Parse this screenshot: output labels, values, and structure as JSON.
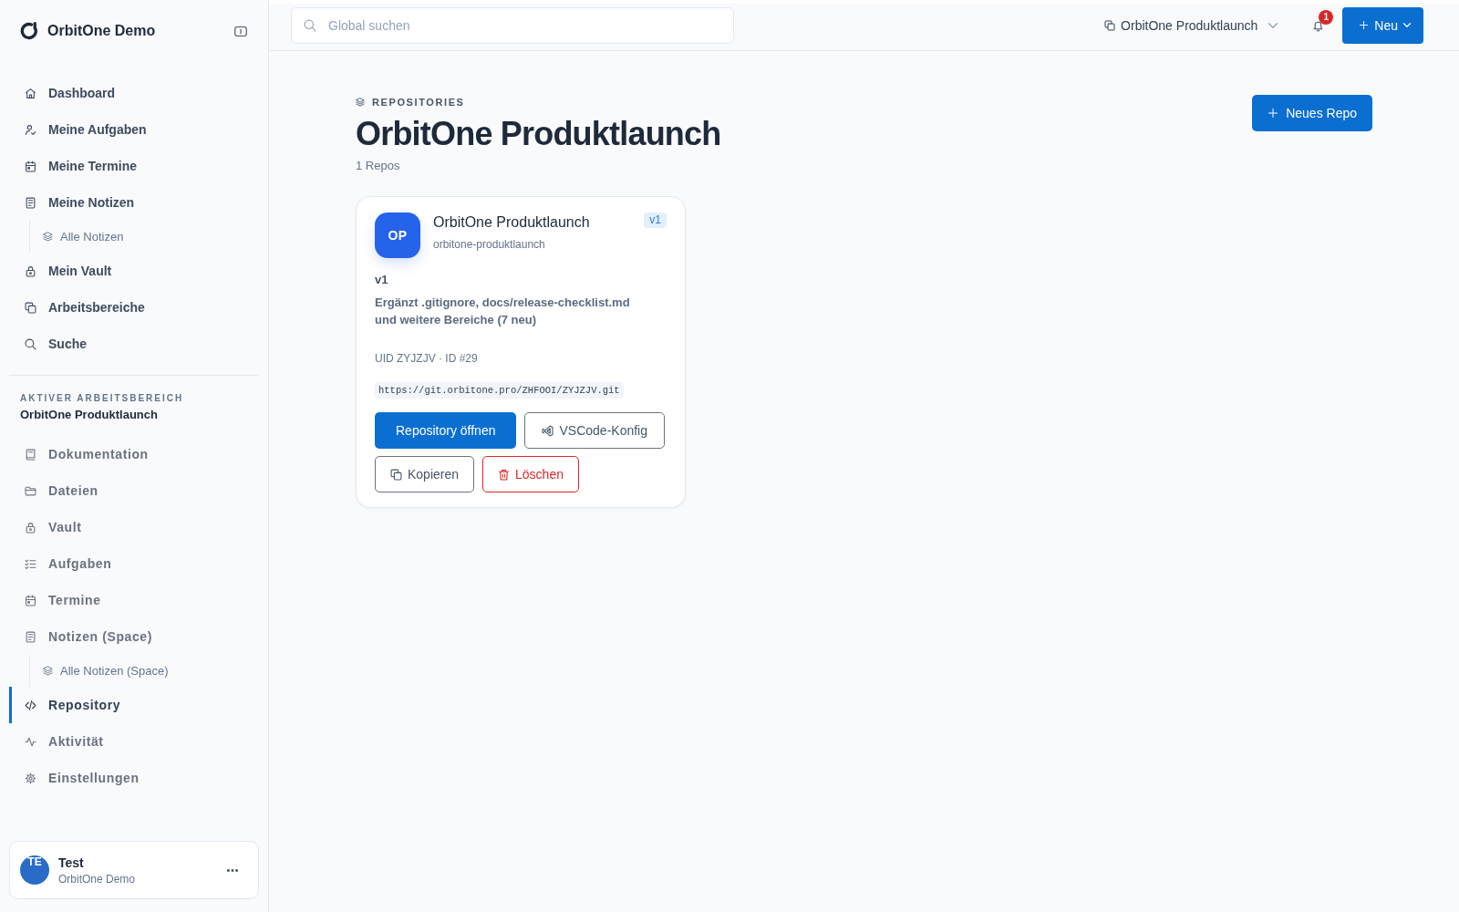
{
  "sidebar": {
    "brand": "OrbitOne Demo",
    "personal_nav": [
      {
        "label": "Dashboard",
        "selected": false
      },
      {
        "label": "Meine Aufgaben",
        "selected": false
      },
      {
        "label": "Meine Termine",
        "selected": false
      },
      {
        "label": "Meine Notizen",
        "selected": false,
        "children": [
          {
            "label": "Alle Notizen",
            "selected": false
          }
        ]
      },
      {
        "label": "Mein Vault",
        "selected": false
      },
      {
        "label": "Arbeitsbereiche",
        "selected": false
      },
      {
        "label": "Suche",
        "selected": false
      }
    ],
    "workspace": {
      "caption": "AKTIVER ARBEITSBEREICH",
      "name": "OrbitOne Produktlaunch"
    },
    "workspace_nav": [
      {
        "label": "Dokumentation",
        "selected": false
      },
      {
        "label": "Dateien",
        "selected": false
      },
      {
        "label": "Vault",
        "selected": false
      },
      {
        "label": "Aufgaben",
        "selected": false
      },
      {
        "label": "Termine",
        "selected": false
      },
      {
        "label": "Notizen (Space)",
        "selected": false,
        "children": [
          {
            "label": "Alle Notizen (Space)",
            "selected": false
          }
        ]
      },
      {
        "label": "Repository",
        "selected": true
      },
      {
        "label": "Aktivität",
        "selected": false
      },
      {
        "label": "Einstellungen",
        "selected": false
      }
    ],
    "user": {
      "initials": "TE",
      "name": "Test",
      "org": "OrbitOne Demo"
    }
  },
  "topbar": {
    "search": {
      "placeholder": "Global suchen"
    },
    "workspace_picker": "OrbitOne Produktlaunch",
    "notifications": {
      "count": "1"
    },
    "new_button": "Neu"
  },
  "page_header": {
    "eyebrow": "REPOSITORIES",
    "title": "OrbitOne Produktlaunch",
    "count": "1 Repos",
    "new_repo_button": "Neues Repo"
  },
  "repos": [
    {
      "initials": "OP",
      "name": "OrbitOne Produktlaunch",
      "slug": "orbitone-produktlaunch",
      "badge": "v1",
      "version": "v1",
      "description": "Ergänzt .gitignore, docs/release-checklist.md und weitere Bereiche (7 neu)",
      "meta": "UID ZYJZJV · ID #29",
      "url": "https://git.orbitone.pro/ZHFOOI/ZYJZJV.git",
      "actions": [
        {
          "label": "Repository öffnen",
          "kind": "open"
        },
        {
          "label": "VSCode-Konfig",
          "kind": "config"
        },
        {
          "label": "Kopieren",
          "kind": "copy"
        },
        {
          "label": "Löschen",
          "kind": "delete"
        }
      ]
    }
  ]
}
